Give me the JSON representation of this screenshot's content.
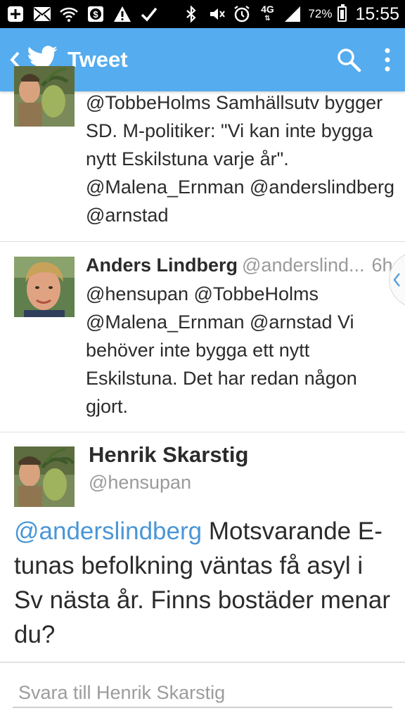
{
  "status_bar": {
    "battery": "72%",
    "time": "15:55",
    "network": "4G"
  },
  "app_bar": {
    "title": "Tweet",
    "back_icon": "chevron-left-icon",
    "logo_icon": "twitter-bird-icon",
    "search_icon": "search-icon",
    "menu_icon": "overflow-menu-icon",
    "color": "#55acee"
  },
  "thread": [
    {
      "text": "@TobbeHolms Samhällsutv bygger SD. M-politiker: \"Vi kan inte bygga nytt Eskilstuna varje år\". @Malena_Ernman @anderslindberg @arnstad"
    },
    {
      "name": "Anders Lindberg",
      "handle": "@anderslind...",
      "time": "6h",
      "text": "@hensupan @TobbeHolms @Malena_Ernman @arnstad Vi behöver inte bygga ett nytt Eskilstuna. Det har redan någon gjort."
    }
  ],
  "detail": {
    "name": "Henrik Skarstig",
    "handle": "@hensupan",
    "mention": "@anderslindberg",
    "text": " Motsvarande E-tunas befolkning väntas få asyl i Sv nästa år. Finns bostäder menar du?"
  },
  "reply": {
    "placeholder": "Svara till Henrik Skarstig"
  },
  "colors": {
    "mention": "#4a96d6",
    "muted": "#9a9a9a"
  }
}
